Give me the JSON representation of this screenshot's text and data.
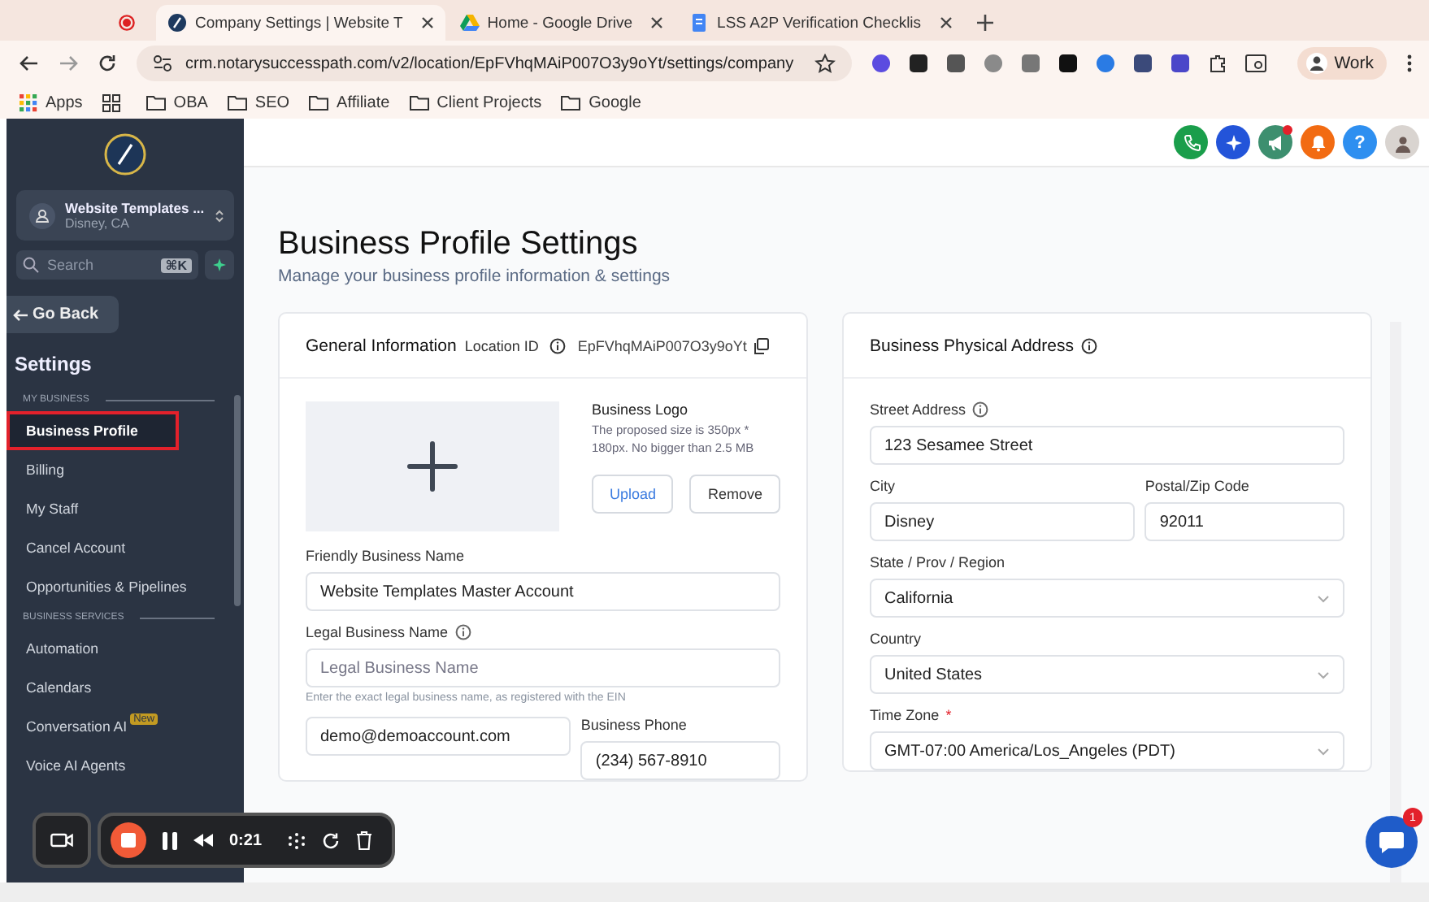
{
  "browser": {
    "tabs": [
      {
        "kind": "pinned",
        "selected": false
      },
      {
        "kind": "page",
        "title": "Company Settings | Website T",
        "selected": true
      },
      {
        "kind": "page",
        "title": "Home - Google Drive",
        "selected": false
      },
      {
        "kind": "page",
        "title": "LSS A2P Verification Checklis",
        "selected": false
      }
    ],
    "url": "crm.notarysuccesspath.com/v2/location/EpFVhqMAiP007O3y9oYt/settings/company",
    "profile": "Work",
    "bookmarks": [
      {
        "kind": "apps",
        "label": "Apps"
      },
      {
        "kind": "grid"
      },
      {
        "kind": "folder",
        "label": "OBA"
      },
      {
        "kind": "folder",
        "label": "SEO"
      },
      {
        "kind": "folder",
        "label": "Affiliate"
      },
      {
        "kind": "folder",
        "label": "Client Projects"
      },
      {
        "kind": "folder",
        "label": "Google"
      }
    ]
  },
  "sidebar": {
    "account": {
      "name": "Website Templates ...",
      "location": "Disney, CA"
    },
    "search": {
      "placeholder": "Search",
      "shortcut": "⌘K"
    },
    "back": "Go Back",
    "heading": "Settings",
    "sections": [
      {
        "title": "MY BUSINESS",
        "items": [
          {
            "label": "Business Profile",
            "selected": true
          },
          {
            "label": "Billing",
            "selected": false
          },
          {
            "label": "My Staff",
            "selected": false
          },
          {
            "label": "Cancel Account",
            "selected": false
          },
          {
            "label": "Opportunities & Pipelines",
            "selected": false
          }
        ]
      },
      {
        "title": "BUSINESS SERVICES",
        "items": [
          {
            "label": "Automation",
            "selected": false
          },
          {
            "label": "Calendars",
            "selected": false
          },
          {
            "label": "Conversation AI",
            "selected": false,
            "badge": "New"
          },
          {
            "label": "Voice AI Agents",
            "selected": false
          }
        ]
      }
    ]
  },
  "header_buttons": [
    {
      "kind": "phone",
      "color": "#1a9e4b"
    },
    {
      "kind": "sparkle",
      "color": "#2354d9"
    },
    {
      "kind": "megaphone",
      "color": "#3d8f6f",
      "dot": true
    },
    {
      "kind": "bell",
      "color": "#f26b12"
    },
    {
      "kind": "help",
      "color": "#2e8ff0",
      "label": "?"
    },
    {
      "kind": "avatar",
      "color": "#d9d4d0"
    }
  ],
  "page": {
    "title": "Business Profile Settings",
    "subtitle": "Manage your business profile information & settings"
  },
  "general": {
    "title": "General Information",
    "location_label": "Location ID",
    "location_id": "EpFVhqMAiP007O3y9oYt",
    "logo": {
      "title": "Business Logo",
      "hint": "The proposed size is 350px * 180px. No bigger than 2.5 MB",
      "buttons": [
        {
          "label": "Upload",
          "kind": "primary"
        },
        {
          "label": "Remove",
          "kind": "plain"
        }
      ]
    },
    "rows": [
      [
        {
          "kind": "input",
          "label": "Friendly Business Name",
          "value": "Website Templates Master Account"
        }
      ],
      [
        {
          "kind": "input",
          "label": "Legal Business Name",
          "placeholder": "Legal Business Name",
          "hint": "Enter the exact legal business name, as registered with the EIN",
          "info": true
        }
      ],
      [
        {
          "kind": "input",
          "value": "demo@demoaccount.com"
        },
        {
          "kind": "input",
          "label": "Business Phone",
          "value": "(234) 567-8910"
        }
      ]
    ]
  },
  "address": {
    "title": "Business Physical Address",
    "rows": [
      [
        {
          "kind": "input",
          "label": "Street Address",
          "value": "123 Sesamee Street",
          "info": true
        }
      ],
      [
        {
          "kind": "input",
          "label": "City",
          "value": "Disney"
        },
        {
          "kind": "input",
          "label": "Postal/Zip Code",
          "value": "92011"
        }
      ],
      [
        {
          "kind": "select",
          "label": "State / Prov / Region",
          "value": "California"
        }
      ],
      [
        {
          "kind": "select",
          "label": "Country",
          "value": "United States"
        }
      ],
      [
        {
          "kind": "select",
          "label": "Time Zone",
          "value": "GMT-07:00 America/Los_Angeles (PDT)",
          "required_mark": "*"
        }
      ]
    ]
  },
  "recorder": {
    "time": "0:21"
  },
  "chat": {
    "badge": "1"
  }
}
